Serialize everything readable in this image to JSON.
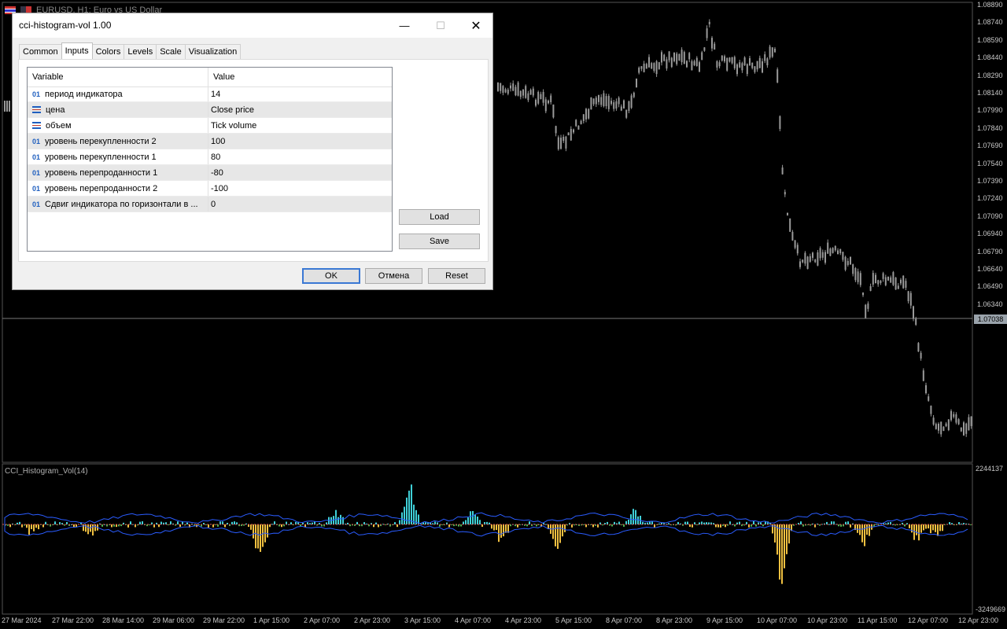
{
  "chart": {
    "symbol_title": "EURUSD, H1: Euro vs US Dollar",
    "indicator_label": "CCI_Histogram_Vol(14)",
    "price_axis": [
      "1.08890",
      "1.08740",
      "1.08590",
      "1.08440",
      "1.08290",
      "1.08140",
      "1.07990",
      "1.07840",
      "1.07690",
      "1.07540",
      "1.07390",
      "1.07240",
      "1.07090",
      "1.06940",
      "1.06790",
      "1.06640",
      "1.06490",
      "1.06340"
    ],
    "current_price": "1.07038",
    "indicator_axis": {
      "max": "2244137",
      "min": "-3249669"
    },
    "time_axis": [
      "27 Mar 2024",
      "27 Mar 22:00",
      "28 Mar 14:00",
      "29 Mar 06:00",
      "29 Mar 22:00",
      "1 Apr 15:00",
      "2 Apr 07:00",
      "2 Apr 23:00",
      "3 Apr 15:00",
      "4 Apr 07:00",
      "4 Apr 23:00",
      "5 Apr 15:00",
      "8 Apr 07:00",
      "8 Apr 23:00",
      "9 Apr 15:00",
      "10 Apr 07:00",
      "10 Apr 23:00",
      "11 Apr 15:00",
      "12 Apr 07:00",
      "12 Apr 23:00"
    ],
    "colors": {
      "bull_hist": "#3fd0d8",
      "bear_hist": "#f0c040",
      "neutral_hist": "#4caf50",
      "envelope": "#2a5cff",
      "candle": "#9a9a9a"
    }
  },
  "dialog": {
    "title": "cci-histogram-vol 1.00",
    "tabs": [
      "Common",
      "Inputs",
      "Colors",
      "Levels",
      "Scale",
      "Visualization"
    ],
    "active_tab": "Inputs",
    "columns": {
      "variable": "Variable",
      "value": "Value"
    },
    "rows": [
      {
        "type": "int",
        "icon_text": "01",
        "variable": "период индикатора",
        "value": "14"
      },
      {
        "type": "enum",
        "icon_text": "",
        "variable": "цена",
        "value": "Close price"
      },
      {
        "type": "enum",
        "icon_text": "",
        "variable": "объем",
        "value": "Tick volume"
      },
      {
        "type": "int",
        "icon_text": "01",
        "variable": "уровень перекупленности 2",
        "value": "100"
      },
      {
        "type": "int",
        "icon_text": "01",
        "variable": "уровень перекупленности 1",
        "value": "80"
      },
      {
        "type": "int",
        "icon_text": "01",
        "variable": "уровень перепроданности 1",
        "value": "-80"
      },
      {
        "type": "int",
        "icon_text": "01",
        "variable": "уровень перепроданности 2",
        "value": "-100"
      },
      {
        "type": "int",
        "icon_text": "01",
        "variable": "Сдвиг индикатора по горизонтали в ...",
        "value": "0"
      }
    ],
    "buttons": {
      "load": "Load",
      "save": "Save",
      "ok": "OK",
      "cancel": "Отмена",
      "reset": "Reset"
    }
  }
}
